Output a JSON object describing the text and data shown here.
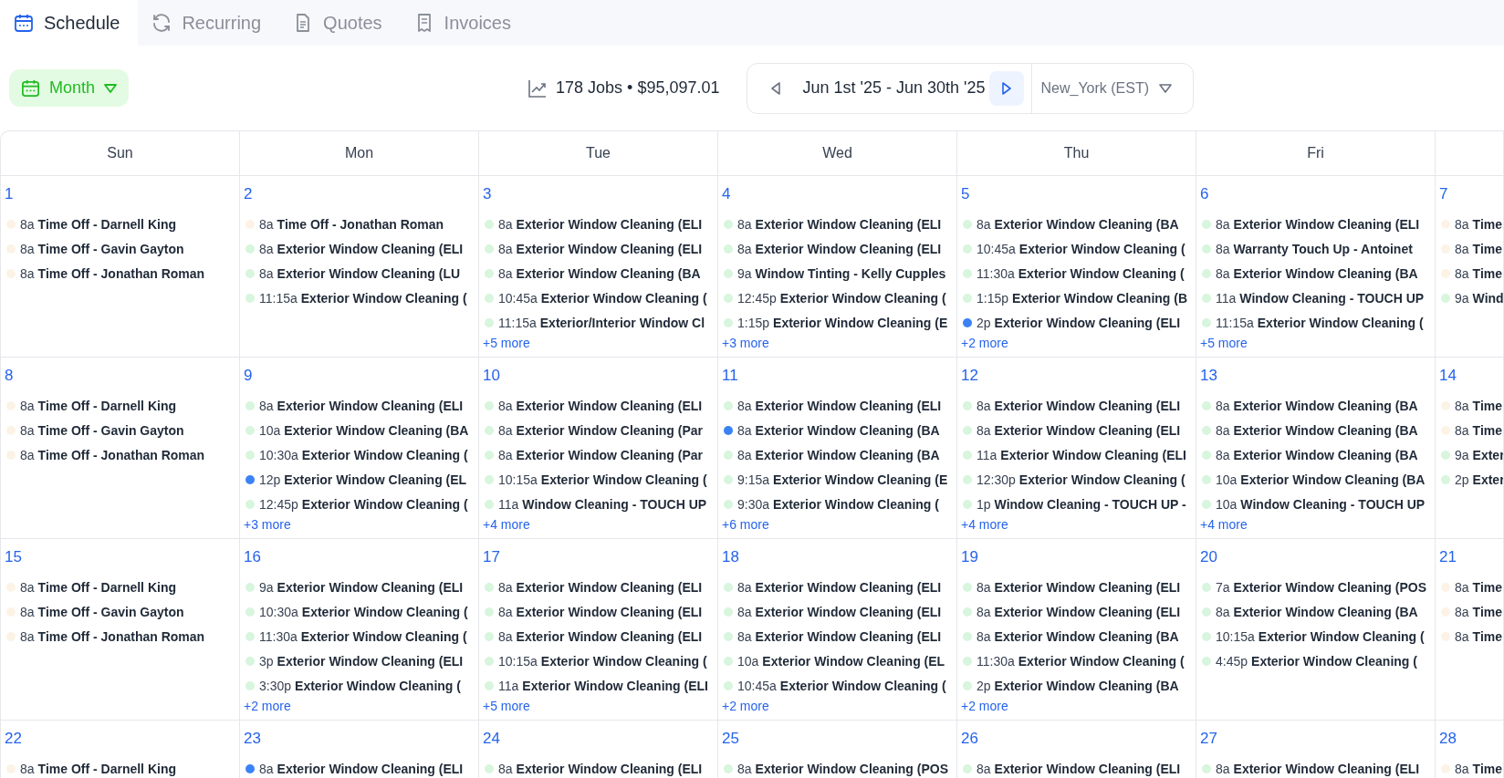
{
  "tabs": [
    {
      "label": "Schedule",
      "selected": true,
      "kind": "calendar"
    },
    {
      "label": "Recurring",
      "selected": false,
      "kind": "recurring"
    },
    {
      "label": "Quotes",
      "selected": false,
      "kind": "document"
    },
    {
      "label": "Invoices",
      "selected": false,
      "kind": "receipt"
    }
  ],
  "view_button": {
    "label": "Month"
  },
  "summary": "178 Jobs • $95,097.01",
  "date_range": "Jun 1st '25 - Jun 30th '25",
  "timezone": "New_York (EST)",
  "calendar": {
    "weekdays": [
      "Sun",
      "Mon",
      "Tue",
      "Wed",
      "Thu",
      "Fri"
    ],
    "weeks": [
      [
        {
          "day": "1",
          "events": [
            {
              "time": "8a",
              "title": "Time Off - Darnell King",
              "color": "#fcf3e6"
            },
            {
              "time": "8a",
              "title": "Time Off - Gavin Gayton",
              "color": "#fcf3e6"
            },
            {
              "time": "8a",
              "title": "Time Off - Jonathan Roman",
              "color": "#fcf3e6"
            }
          ]
        },
        {
          "day": "2",
          "events": [
            {
              "time": "8a",
              "title": "Time Off - Jonathan Roman",
              "color": "#fcf3e6"
            },
            {
              "time": "8a",
              "title": "Exterior Window Cleaning (ELI",
              "color": "#d8f5dd"
            },
            {
              "time": "8a",
              "title": "Exterior Window Cleaning (LU",
              "color": "#d8f5dd"
            },
            {
              "time": "11:15a",
              "title": "Exterior Window Cleaning (",
              "color": "#d8f5dd"
            }
          ]
        },
        {
          "day": "3",
          "events": [
            {
              "time": "8a",
              "title": "Exterior Window Cleaning (ELI",
              "color": "#d8f5dd"
            },
            {
              "time": "8a",
              "title": "Exterior Window Cleaning (ELI",
              "color": "#d8f5dd"
            },
            {
              "time": "8a",
              "title": "Exterior Window Cleaning (BA",
              "color": "#d8f5dd"
            },
            {
              "time": "10:45a",
              "title": "Exterior Window Cleaning (",
              "color": "#d8f5dd"
            },
            {
              "time": "11:15a",
              "title": "Exterior/Interior Window Cl",
              "color": "#d8f5dd"
            }
          ],
          "more": "+5 more"
        },
        {
          "day": "4",
          "events": [
            {
              "time": "8a",
              "title": "Exterior Window Cleaning (ELI",
              "color": "#d8f5dd"
            },
            {
              "time": "8a",
              "title": "Exterior Window Cleaning (ELI",
              "color": "#d8f5dd"
            },
            {
              "time": "9a",
              "title": "Window Tinting - Kelly Cupples",
              "color": "#d8f5dd"
            },
            {
              "time": "12:45p",
              "title": "Exterior Window Cleaning (",
              "color": "#d8f5dd"
            },
            {
              "time": "1:15p",
              "title": "Exterior Window Cleaning (E",
              "color": "#d8f5dd"
            }
          ],
          "more": "+3 more"
        },
        {
          "day": "5",
          "events": [
            {
              "time": "8a",
              "title": "Exterior Window Cleaning (BA",
              "color": "#d8f5dd"
            },
            {
              "time": "10:45a",
              "title": "Exterior Window Cleaning (",
              "color": "#d8f5dd"
            },
            {
              "time": "11:30a",
              "title": "Exterior Window Cleaning (",
              "color": "#d8f5dd"
            },
            {
              "time": "1:15p",
              "title": "Exterior Window Cleaning (B",
              "color": "#d8f5dd"
            },
            {
              "time": "2p",
              "title": "Exterior Window Cleaning (ELI",
              "color": "#3b82f6"
            }
          ],
          "more": "+2 more"
        },
        {
          "day": "6",
          "events": [
            {
              "time": "8a",
              "title": "Exterior Window Cleaning (ELI",
              "color": "#d8f5dd"
            },
            {
              "time": "8a",
              "title": "Warranty Touch Up - Antoinet",
              "color": "#d8f5dd"
            },
            {
              "time": "8a",
              "title": "Exterior Window Cleaning (BA",
              "color": "#d8f5dd"
            },
            {
              "time": "11a",
              "title": "Window Cleaning - TOUCH UP",
              "color": "#d8f5dd"
            },
            {
              "time": "11:15a",
              "title": "Exterior Window Cleaning (",
              "color": "#d8f5dd"
            }
          ],
          "more": "+5 more"
        },
        {
          "day": "7",
          "events": [
            {
              "time": "8a",
              "title": "Time",
              "color": "#fcf3e6"
            },
            {
              "time": "8a",
              "title": "Time",
              "color": "#fcf3e6"
            },
            {
              "time": "8a",
              "title": "Time",
              "color": "#fcf3e6"
            },
            {
              "time": "9a",
              "title": "Wind",
              "color": "#d8f5dd"
            }
          ]
        }
      ],
      [
        {
          "day": "8",
          "events": [
            {
              "time": "8a",
              "title": "Time Off - Darnell King",
              "color": "#fcf3e6"
            },
            {
              "time": "8a",
              "title": "Time Off - Gavin Gayton",
              "color": "#fcf3e6"
            },
            {
              "time": "8a",
              "title": "Time Off - Jonathan Roman",
              "color": "#fcf3e6"
            }
          ]
        },
        {
          "day": "9",
          "events": [
            {
              "time": "8a",
              "title": "Exterior Window Cleaning (ELI",
              "color": "#d8f5dd"
            },
            {
              "time": "10a",
              "title": "Exterior Window Cleaning (BA",
              "color": "#d8f5dd"
            },
            {
              "time": "10:30a",
              "title": "Exterior Window Cleaning (",
              "color": "#d8f5dd"
            },
            {
              "time": "12p",
              "title": "Exterior Window Cleaning (EL",
              "color": "#3b82f6"
            },
            {
              "time": "12:45p",
              "title": "Exterior Window Cleaning (",
              "color": "#d8f5dd"
            }
          ],
          "more": "+3 more"
        },
        {
          "day": "10",
          "events": [
            {
              "time": "8a",
              "title": "Exterior Window Cleaning (ELI",
              "color": "#d8f5dd"
            },
            {
              "time": "8a",
              "title": "Exterior Window Cleaning (Par",
              "color": "#d8f5dd"
            },
            {
              "time": "8a",
              "title": "Exterior Window Cleaning (Par",
              "color": "#d8f5dd"
            },
            {
              "time": "10:15a",
              "title": "Exterior Window Cleaning (",
              "color": "#d8f5dd"
            },
            {
              "time": "11a",
              "title": "Window Cleaning - TOUCH UP",
              "color": "#d8f5dd"
            }
          ],
          "more": "+4 more"
        },
        {
          "day": "11",
          "events": [
            {
              "time": "8a",
              "title": "Exterior Window Cleaning (ELI",
              "color": "#d8f5dd"
            },
            {
              "time": "8a",
              "title": "Exterior Window Cleaning (BA",
              "color": "#3b82f6"
            },
            {
              "time": "8a",
              "title": "Exterior Window Cleaning (BA",
              "color": "#d8f5dd"
            },
            {
              "time": "9:15a",
              "title": "Exterior Window Cleaning (E",
              "color": "#d8f5dd"
            },
            {
              "time": "9:30a",
              "title": "Exterior Window Cleaning (",
              "color": "#d8f5dd"
            }
          ],
          "more": "+6 more"
        },
        {
          "day": "12",
          "events": [
            {
              "time": "8a",
              "title": "Exterior Window Cleaning (ELI",
              "color": "#d8f5dd"
            },
            {
              "time": "8a",
              "title": "Exterior Window Cleaning (ELI",
              "color": "#d8f5dd"
            },
            {
              "time": "11a",
              "title": "Exterior Window Cleaning (ELI",
              "color": "#d8f5dd"
            },
            {
              "time": "12:30p",
              "title": "Exterior Window Cleaning (",
              "color": "#d8f5dd"
            },
            {
              "time": "1p",
              "title": "Window Cleaning - TOUCH UP -",
              "color": "#d8f5dd"
            }
          ],
          "more": "+4 more"
        },
        {
          "day": "13",
          "events": [
            {
              "time": "8a",
              "title": "Exterior Window Cleaning (BA",
              "color": "#d8f5dd"
            },
            {
              "time": "8a",
              "title": "Exterior Window Cleaning (BA",
              "color": "#d8f5dd"
            },
            {
              "time": "8a",
              "title": "Exterior Window Cleaning (BA",
              "color": "#d8f5dd"
            },
            {
              "time": "10a",
              "title": "Exterior Window Cleaning (BA",
              "color": "#d8f5dd"
            },
            {
              "time": "10a",
              "title": "Window Cleaning - TOUCH UP",
              "color": "#d8f5dd"
            }
          ],
          "more": "+4 more"
        },
        {
          "day": "14",
          "events": [
            {
              "time": "8a",
              "title": "Time",
              "color": "#fcf3e6"
            },
            {
              "time": "8a",
              "title": "Time",
              "color": "#fcf3e6"
            },
            {
              "time": "9a",
              "title": "Exter",
              "color": "#d8f5dd"
            },
            {
              "time": "2p",
              "title": "Exter",
              "color": "#d8f5dd"
            }
          ]
        }
      ],
      [
        {
          "day": "15",
          "events": [
            {
              "time": "8a",
              "title": "Time Off - Darnell King",
              "color": "#fcf3e6"
            },
            {
              "time": "8a",
              "title": "Time Off - Gavin Gayton",
              "color": "#fcf3e6"
            },
            {
              "time": "8a",
              "title": "Time Off - Jonathan Roman",
              "color": "#fcf3e6"
            }
          ]
        },
        {
          "day": "16",
          "events": [
            {
              "time": "9a",
              "title": "Exterior Window Cleaning (ELI",
              "color": "#d8f5dd"
            },
            {
              "time": "10:30a",
              "title": "Exterior Window Cleaning (",
              "color": "#d8f5dd"
            },
            {
              "time": "11:30a",
              "title": "Exterior Window Cleaning (",
              "color": "#d8f5dd"
            },
            {
              "time": "3p",
              "title": "Exterior Window Cleaning (ELI",
              "color": "#d8f5dd"
            },
            {
              "time": "3:30p",
              "title": "Exterior Window Cleaning (",
              "color": "#d8f5dd"
            }
          ],
          "more": "+2 more"
        },
        {
          "day": "17",
          "events": [
            {
              "time": "8a",
              "title": "Exterior Window Cleaning (ELI",
              "color": "#d8f5dd"
            },
            {
              "time": "8a",
              "title": "Exterior Window Cleaning (ELI",
              "color": "#d8f5dd"
            },
            {
              "time": "8a",
              "title": "Exterior Window Cleaning (ELI",
              "color": "#d8f5dd"
            },
            {
              "time": "10:15a",
              "title": "Exterior Window Cleaning (",
              "color": "#d8f5dd"
            },
            {
              "time": "11a",
              "title": "Exterior Window Cleaning (ELI",
              "color": "#d8f5dd"
            }
          ],
          "more": "+5 more"
        },
        {
          "day": "18",
          "events": [
            {
              "time": "8a",
              "title": "Exterior Window Cleaning (ELI",
              "color": "#d8f5dd"
            },
            {
              "time": "8a",
              "title": "Exterior Window Cleaning (ELI",
              "color": "#d8f5dd"
            },
            {
              "time": "8a",
              "title": "Exterior Window Cleaning (ELI",
              "color": "#d8f5dd"
            },
            {
              "time": "10a",
              "title": "Exterior Window Cleaning (EL",
              "color": "#d8f5dd"
            },
            {
              "time": "10:45a",
              "title": "Exterior Window Cleaning (",
              "color": "#d8f5dd"
            }
          ],
          "more": "+2 more"
        },
        {
          "day": "19",
          "events": [
            {
              "time": "8a",
              "title": "Exterior Window Cleaning (ELI",
              "color": "#d8f5dd"
            },
            {
              "time": "8a",
              "title": "Exterior Window Cleaning (ELI",
              "color": "#d8f5dd"
            },
            {
              "time": "8a",
              "title": "Exterior Window Cleaning (BA",
              "color": "#d8f5dd"
            },
            {
              "time": "11:30a",
              "title": "Exterior Window Cleaning (",
              "color": "#d8f5dd"
            },
            {
              "time": "2p",
              "title": "Exterior Window Cleaning (BA",
              "color": "#d8f5dd"
            }
          ],
          "more": "+2 more"
        },
        {
          "day": "20",
          "events": [
            {
              "time": "7a",
              "title": "Exterior Window Cleaning (POS",
              "color": "#d8f5dd"
            },
            {
              "time": "8a",
              "title": "Exterior Window Cleaning (BA",
              "color": "#d8f5dd"
            },
            {
              "time": "10:15a",
              "title": "Exterior Window Cleaning (",
              "color": "#d8f5dd"
            },
            {
              "time": "4:45p",
              "title": "Exterior Window Cleaning (",
              "color": "#d8f5dd"
            }
          ]
        },
        {
          "day": "21",
          "events": [
            {
              "time": "8a",
              "title": "Time",
              "color": "#fcf3e6"
            },
            {
              "time": "8a",
              "title": "Time",
              "color": "#fcf3e6"
            },
            {
              "time": "8a",
              "title": "Time",
              "color": "#fcf3e6"
            }
          ]
        }
      ],
      [
        {
          "day": "22",
          "events": [
            {
              "time": "8a",
              "title": "Time Off - Darnell King",
              "color": "#fcf3e6"
            }
          ]
        },
        {
          "day": "23",
          "events": [
            {
              "time": "8a",
              "title": "Exterior Window Cleaning (ELI",
              "color": "#3b82f6"
            }
          ]
        },
        {
          "day": "24",
          "events": [
            {
              "time": "8a",
              "title": "Exterior Window Cleaning (ELI",
              "color": "#d8f5dd"
            }
          ]
        },
        {
          "day": "25",
          "events": [
            {
              "time": "8a",
              "title": "Exterior Window Cleaning (POS",
              "color": "#d8f5dd"
            }
          ]
        },
        {
          "day": "26",
          "events": [
            {
              "time": "8a",
              "title": "Exterior Window Cleaning (ELI",
              "color": "#d8f5dd"
            }
          ]
        },
        {
          "day": "27",
          "events": [
            {
              "time": "8a",
              "title": "Exterior Window Cleaning (ELI",
              "color": "#d8f5dd"
            }
          ]
        },
        {
          "day": "28",
          "events": [
            {
              "time": "8a",
              "title": "Time",
              "color": "#fcf3e6"
            }
          ]
        }
      ]
    ]
  }
}
